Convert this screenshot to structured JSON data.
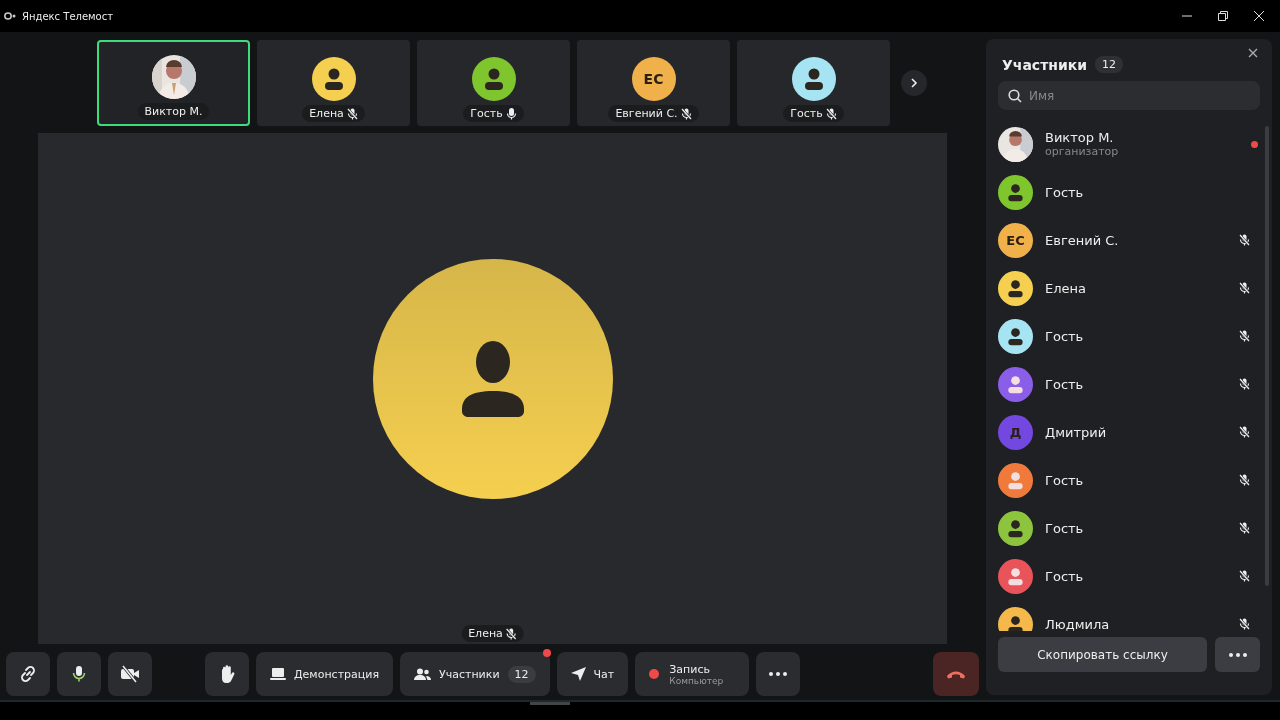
{
  "window": {
    "title": "Яндекс Телемост"
  },
  "tiles": [
    {
      "name": "Виктор М.",
      "selected": true
    },
    {
      "name": "Елена",
      "avatar": {
        "kind": "person",
        "color": "#f5cf4f"
      },
      "muted": true,
      "selected": false
    },
    {
      "name": "Гость",
      "avatar": {
        "kind": "person",
        "color": "#7fc52e"
      },
      "muted": false,
      "selected": false
    },
    {
      "name": "Евгений С.",
      "avatar": {
        "kind": "initials",
        "initials": "ЕС",
        "color": "#f0b04a"
      },
      "muted": true,
      "selected": false
    },
    {
      "name": "Гость",
      "avatar": {
        "kind": "person",
        "color": "#a6e4f4"
      },
      "muted": true,
      "selected": false
    }
  ],
  "stage": {
    "name": "Елена",
    "muted": true,
    "avatar": {
      "kind": "person",
      "color": "#f5cf4f"
    }
  },
  "toolbar": [
    {
      "kind": "link"
    },
    {
      "kind": "mic"
    },
    {
      "kind": "camera"
    },
    {
      "kind": "gap"
    },
    {
      "kind": "hand"
    },
    {
      "kind": "screen",
      "label": "Демонстрация"
    },
    {
      "kind": "participants",
      "label": "Участники",
      "count": "12",
      "alert": true
    },
    {
      "kind": "chat",
      "label": "Чат"
    },
    {
      "kind": "record",
      "label": "Запись",
      "sublabel": "Компьютер"
    },
    {
      "kind": "more"
    }
  ],
  "panel": {
    "title": "Участники",
    "count": "12",
    "search": {
      "placeholder": "Имя"
    },
    "participants": [
      {
        "name": "Виктор М.",
        "role": "организатор",
        "muted": false,
        "recording": true
      },
      {
        "name": "Гость",
        "avatar": {
          "kind": "person",
          "color": "#7fc52e"
        },
        "muted": false,
        "recording": false
      },
      {
        "name": "Евгений С.",
        "avatar": {
          "kind": "initials",
          "initials": "ЕС",
          "color": "#f0b04a"
        },
        "muted": true,
        "recording": false
      },
      {
        "name": "Елена",
        "avatar": {
          "kind": "person",
          "color": "#f5cf4f"
        },
        "muted": true,
        "recording": false
      },
      {
        "name": "Гость",
        "avatar": {
          "kind": "person",
          "color": "#a6e4f4"
        },
        "muted": true,
        "recording": false
      },
      {
        "name": "Гость",
        "avatar": {
          "kind": "pale",
          "color": "#8a5ee8"
        },
        "muted": true,
        "recording": false
      },
      {
        "name": "Дмитрий",
        "avatar": {
          "kind": "initials",
          "initials": "Д",
          "color": "#7248e0"
        },
        "muted": true,
        "recording": false
      },
      {
        "name": "Гость",
        "avatar": {
          "kind": "pale",
          "color": "#f07a3c"
        },
        "muted": true,
        "recording": false
      },
      {
        "name": "Гость",
        "avatar": {
          "kind": "person",
          "color": "#8cc43e"
        },
        "muted": true,
        "recording": false
      },
      {
        "name": "Гость",
        "avatar": {
          "kind": "pale",
          "color": "#e8545a"
        },
        "muted": true,
        "recording": false
      },
      {
        "name": "Людмила",
        "avatar": {
          "kind": "person",
          "color": "#f4b94a"
        },
        "muted": true,
        "recording": false
      }
    ],
    "copy_button": "Скопировать ссылку"
  }
}
